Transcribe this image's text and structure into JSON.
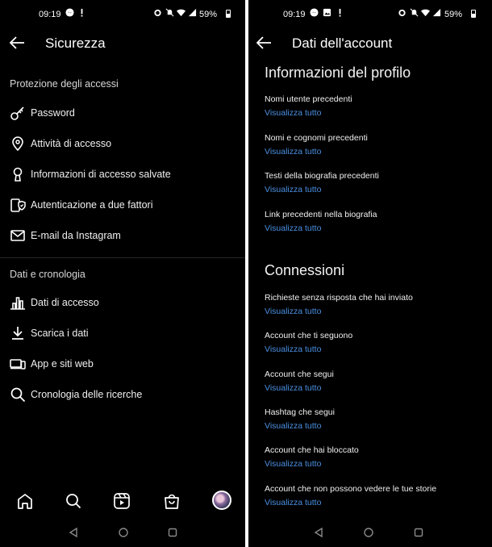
{
  "left": {
    "status": {
      "time": "09:19",
      "battery": "59%"
    },
    "title": "Sicurezza",
    "section1": "Protezione degli accessi",
    "items1": [
      {
        "icon": "key-icon",
        "label": "Password"
      },
      {
        "icon": "location-pin-icon",
        "label": "Attività di accesso"
      },
      {
        "icon": "keyhole-icon",
        "label": "Informazioni di accesso salvate"
      },
      {
        "icon": "two-factor-shield-icon",
        "label": "Autenticazione a due fattori"
      },
      {
        "icon": "mail-icon",
        "label": "E-mail da Instagram"
      }
    ],
    "section2": "Dati e cronologia",
    "items2": [
      {
        "icon": "bar-chart-icon",
        "label": "Dati di accesso"
      },
      {
        "icon": "download-icon",
        "label": "Scarica i dati"
      },
      {
        "icon": "devices-icon",
        "label": "App e siti web"
      },
      {
        "icon": "search-icon",
        "label": "Cronologia delle ricerche"
      }
    ],
    "bottom_nav": [
      "home-icon",
      "search-icon",
      "reels-icon",
      "shop-bag-icon",
      "profile-avatar"
    ]
  },
  "right": {
    "status": {
      "time": "09:19",
      "battery": "59%"
    },
    "title": "Dati dell'account",
    "profile_heading": "Informazioni del profilo",
    "profile_items": [
      {
        "label": "Nomi utente precedenti",
        "link": "Visualizza tutto"
      },
      {
        "label": "Nomi e cognomi precedenti",
        "link": "Visualizza tutto"
      },
      {
        "label": "Testi della biografia precedenti",
        "link": "Visualizza tutto"
      },
      {
        "label": "Link precedenti nella biografia",
        "link": "Visualizza tutto"
      }
    ],
    "connections_heading": "Connessioni",
    "connection_items": [
      {
        "label": "Richieste senza risposta che hai inviato",
        "link": "Visualizza tutto"
      },
      {
        "label": "Account che ti seguono",
        "link": "Visualizza tutto"
      },
      {
        "label": "Account che segui",
        "link": "Visualizza tutto"
      },
      {
        "label": "Hashtag che segui",
        "link": "Visualizza tutto"
      },
      {
        "label": "Account che hai bloccato",
        "link": "Visualizza tutto"
      },
      {
        "label": "Account che non possono vedere le tue storie",
        "link": "Visualizza tutto"
      }
    ]
  },
  "colors": {
    "background": "#000000",
    "text": "#f0f0f0",
    "link": "#4a90e2"
  }
}
